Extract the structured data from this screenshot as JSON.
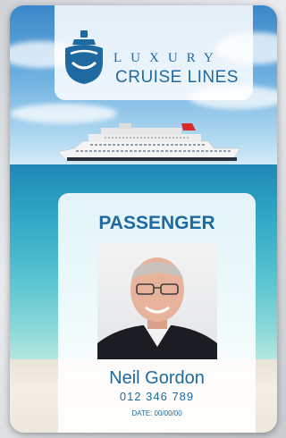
{
  "card": {
    "brand_top": "LUXURY",
    "brand_bottom": "CRUISE LINES",
    "role": "PASSENGER",
    "name": "Neil Gordon",
    "id_number": "012 346 789",
    "date": "DATE: 00/00/00"
  },
  "colors": {
    "accent": "#1e6aa0",
    "sky": "#3b87c9",
    "sea": "#2fa7c6",
    "sand": "#ece7dc"
  },
  "icons": [
    "cruise-ship-logo-icon",
    "cruise-ship-image",
    "passenger-photo"
  ]
}
